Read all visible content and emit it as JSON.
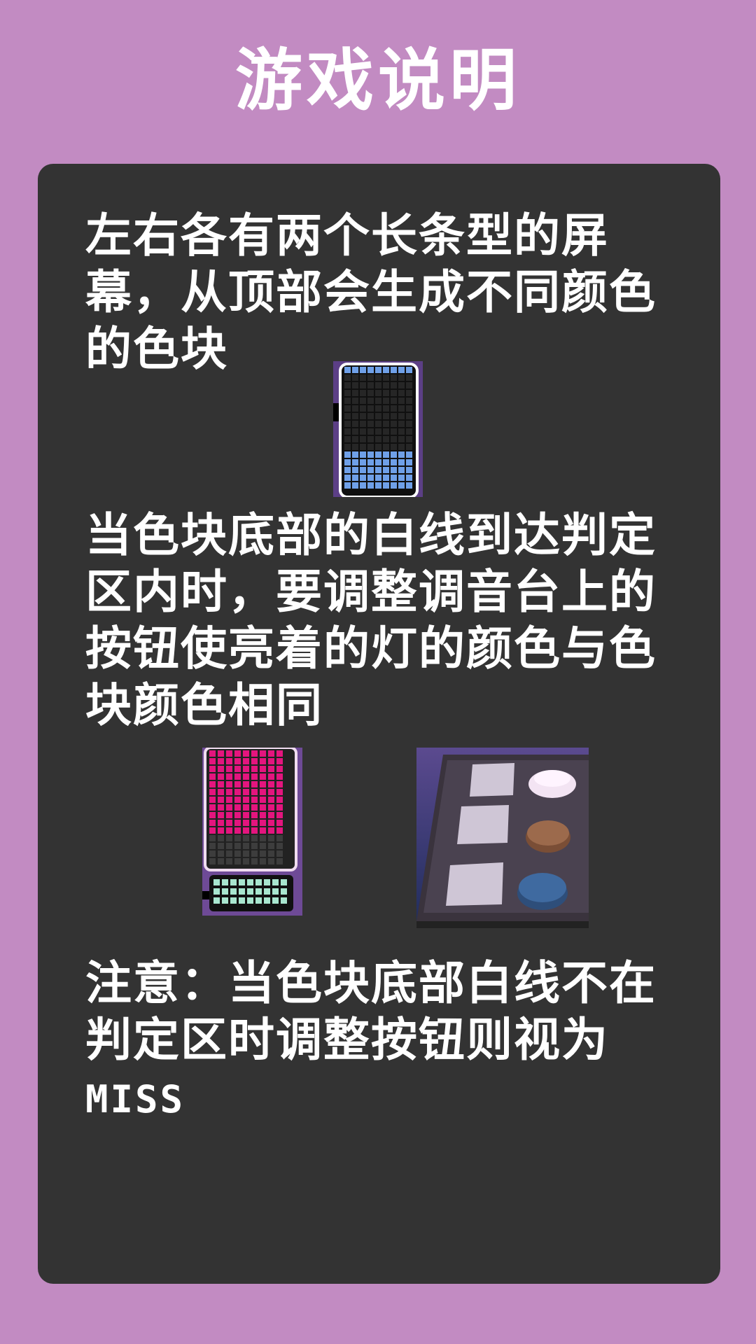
{
  "title": "游戏说明",
  "paragraphs": {
    "p1": "左右各有两个长条型的屏幕，从顶部会生成不同颜色的色块",
    "p2": "当色块底部的白线到达判定区内时，要调整调音台上的按钮使亮着的灯的颜色与色块颜色相同",
    "p3_main": "注意：当色块底部白线不在判定区时调整按钮则视为",
    "p3_tail": "MISS"
  },
  "colors": {
    "background": "#c28bc2",
    "panel": "#333333",
    "text": "#ffffff",
    "block_blue": "#6fa0e8",
    "block_pink": "#e4157e",
    "judge_mint": "#a8e6cf",
    "knob_white": "#f3e4f3",
    "knob_brown": "#9c6a4c",
    "knob_blue": "#3f6aa0"
  },
  "illustrations": {
    "screen_strip_blue": "screen-strip-blue-blocks",
    "screen_strip_pink": "screen-strip-pink-blocks",
    "mixer_console": "mixer-console-buttons"
  }
}
